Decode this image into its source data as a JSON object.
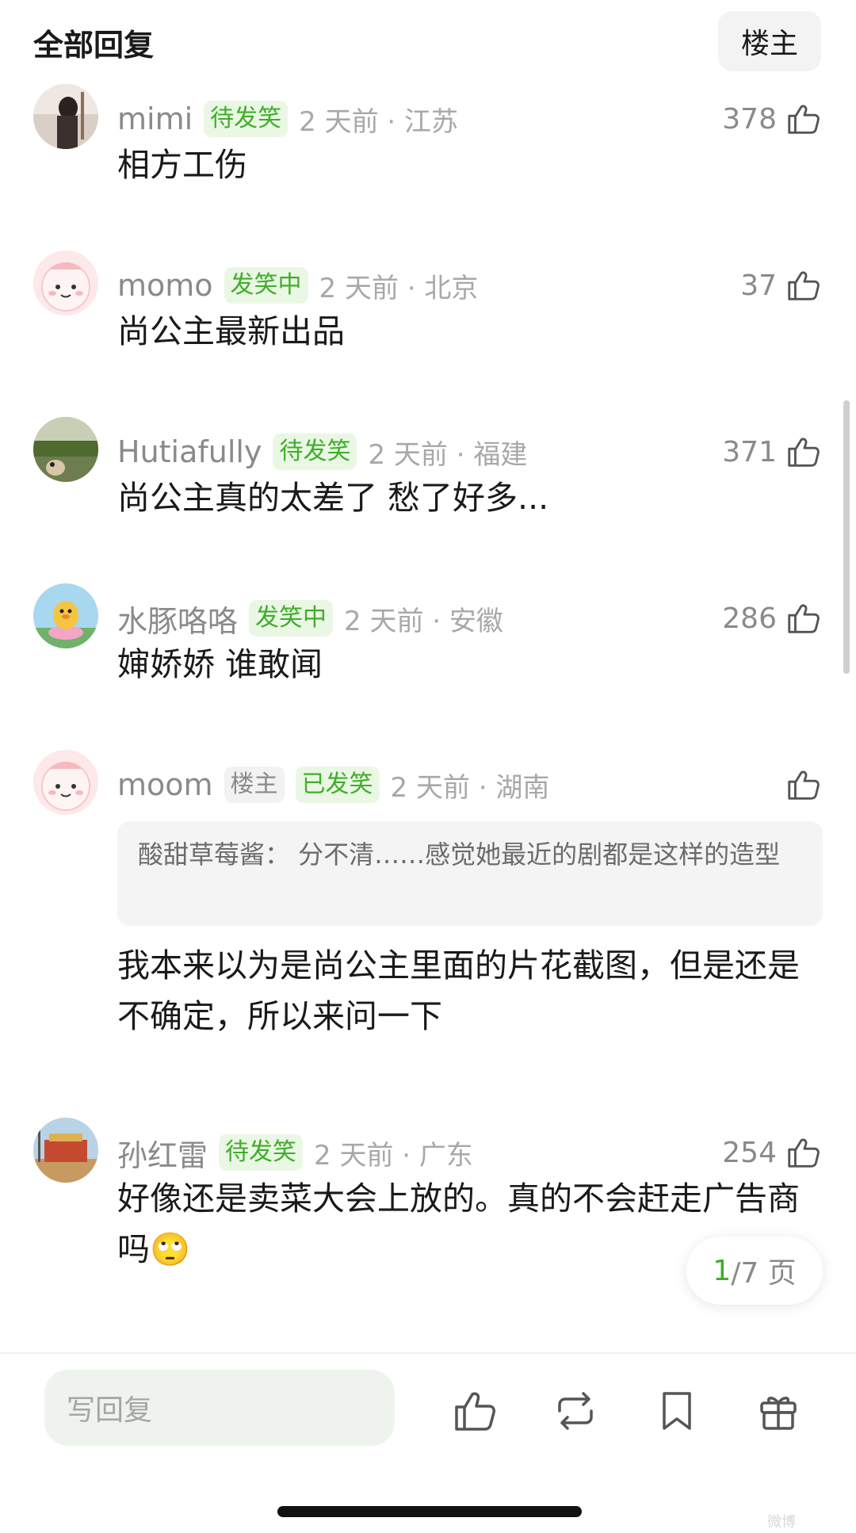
{
  "header": {
    "title": "全部回复",
    "floor_button": "楼主"
  },
  "comments": [
    {
      "username": "mimi",
      "badges": [
        {
          "text": "待发笑",
          "style": "green"
        }
      ],
      "time": "2 天前 · 江苏",
      "likes": "378",
      "text": "相方工伤"
    },
    {
      "username": "momo",
      "badges": [
        {
          "text": "发笑中",
          "style": "green"
        }
      ],
      "time": "2 天前 · 北京",
      "likes": "37",
      "text": "尚公主最新出品"
    },
    {
      "username": "Hutiafully",
      "badges": [
        {
          "text": "待发笑",
          "style": "green"
        }
      ],
      "time": "2 天前 · 福建",
      "likes": "371",
      "text": "尚公主真的太差了 愁了好多..."
    },
    {
      "username": "水豚咯咯",
      "badges": [
        {
          "text": "发笑中",
          "style": "green"
        }
      ],
      "time": "2 天前 · 安徽",
      "likes": "286",
      "text": "婶娇娇 谁敢闻"
    },
    {
      "username": "moom",
      "badges": [
        {
          "text": "楼主",
          "style": "gray"
        },
        {
          "text": "已发笑",
          "style": "green"
        }
      ],
      "time": "2 天前 · 湖南",
      "likes": "",
      "quote": "酸甜草莓酱：  分不清……感觉她最近的剧都是这样的造型",
      "text": "我本来以为是尚公主里面的片花截图，但是还是不确定，所以来问一下"
    },
    {
      "username": "孙红雷",
      "badges": [
        {
          "text": "待发笑",
          "style": "green"
        }
      ],
      "time": "2 天前 · 广东",
      "likes": "254",
      "text": "好像还是卖菜大会上放的。真的不会赶走广告商吗🙄"
    }
  ],
  "pager": {
    "current": "1",
    "total": "/7 页"
  },
  "bottom_bar": {
    "reply_placeholder": "写回复",
    "icons": [
      "thumbs-up-icon",
      "repost-icon",
      "bookmark-icon",
      "gift-icon"
    ]
  },
  "watermark": "微博"
}
